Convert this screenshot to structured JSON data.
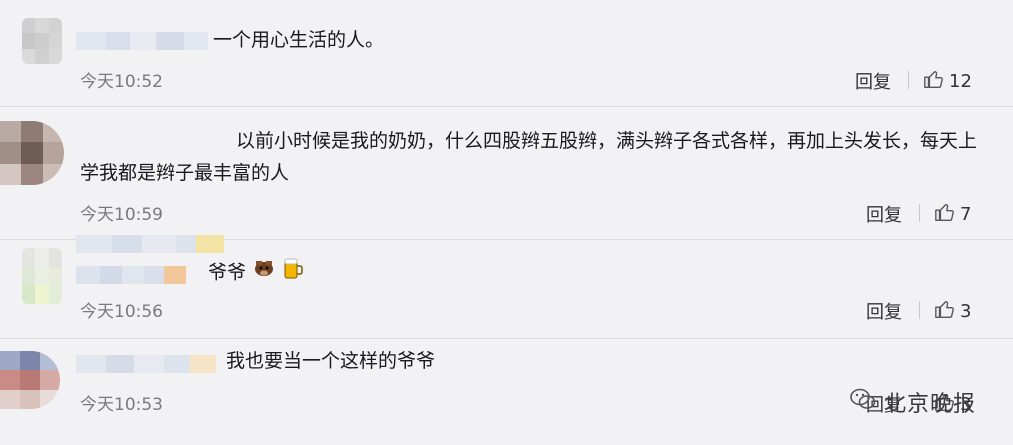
{
  "comments": [
    {
      "text": "一个用心生活的人。",
      "time": "今天10:52",
      "reply_label": "回复",
      "likes": "12"
    },
    {
      "text_line1": "以前小时候是我的奶奶，什么四股辫五股辫，满头辫子各式各样，再加上头发长，每天上",
      "text_line2": "学我都是辫子最丰富的人",
      "time": "今天10:59",
      "reply_label": "回复",
      "likes": "7"
    },
    {
      "text": "爷爷",
      "time": "今天10:56",
      "reply_label": "回复",
      "likes": "3"
    },
    {
      "text": "我也要当一个这样的爷爷",
      "time": "今天10:53",
      "reply_label": "回复",
      "likes": "3"
    }
  ],
  "watermark": {
    "label": "北京晚报"
  },
  "icons": {
    "like": "thumbs-up-icon",
    "emoji_a": "cow-face-emoji",
    "emoji_b": "beer-mug-emoji",
    "watermark": "wechat-icon"
  }
}
